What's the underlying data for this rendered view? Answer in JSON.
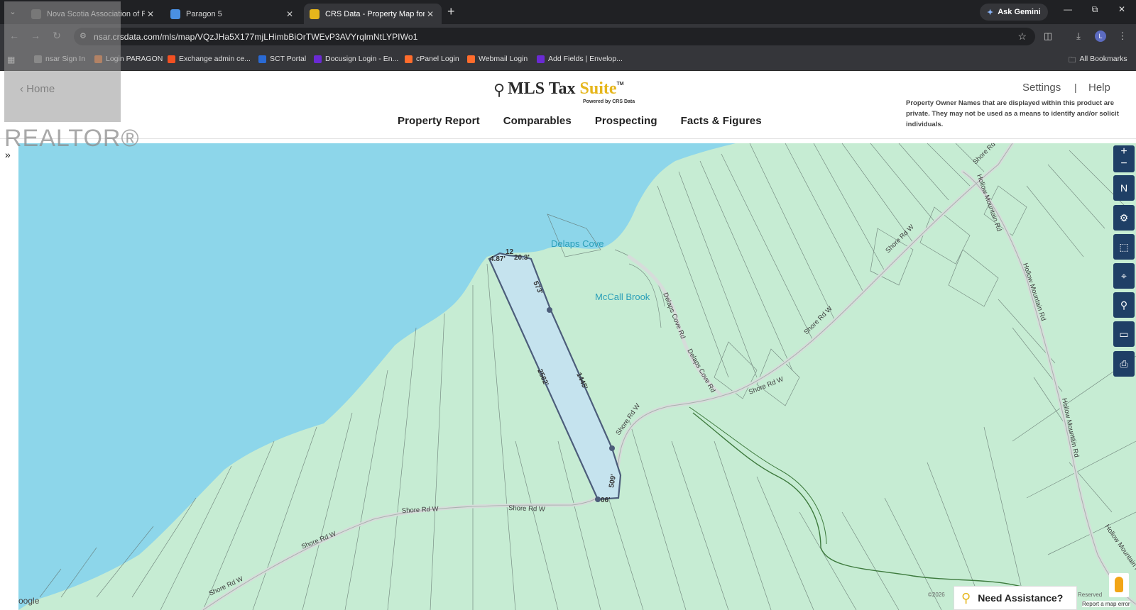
{
  "browser": {
    "tabs": [
      {
        "title": "Nova Scotia Association of Real",
        "icon_color": "#555555",
        "active": false
      },
      {
        "title": "Paragon 5",
        "icon_color": "#4a90e2",
        "active": false
      },
      {
        "title": "CRS Data - Property Map for Sh",
        "icon_color": "#e6b61c",
        "active": true
      }
    ],
    "new_tab": "+",
    "ask_gemini": "Ask Gemini",
    "url": "nsar.crsdata.com/mls/map/VQzJHa5X177mjLHimbBiOrTWEvP3AVYrqlmNtLYPIWo1",
    "profile_initial": "L",
    "bookmarks": [
      {
        "label": "nsar Sign In",
        "color": "#7a7a7a"
      },
      {
        "label": "Login PARAGON",
        "color": "#d46a2a"
      },
      {
        "label": "Exchange admin ce...",
        "color": "#f25022"
      },
      {
        "label": "SCT Portal",
        "color": "#2a6ad4"
      },
      {
        "label": "Docusign Login - En...",
        "color": "#6a2ad4"
      },
      {
        "label": "cPanel Login",
        "color": "#ff6c2c"
      },
      {
        "label": "Webmail Login",
        "color": "#ff6c2c"
      },
      {
        "label": "Add Fields | Envelop...",
        "color": "#6a2ad4"
      }
    ],
    "all_bookmarks": "All Bookmarks"
  },
  "header": {
    "home": "Home",
    "brand_main": "MLS Tax ",
    "brand_accent": "Suite",
    "tm": "TM",
    "powered_by": "Powered by CRS Data",
    "nav": [
      "Property Report",
      "Comparables",
      "Prospecting",
      "Facts & Figures"
    ],
    "settings": "Settings",
    "separator": "|",
    "help": "Help",
    "privacy_notice": "Property Owner Names that are displayed within this product are private. They may not be used as a means to identify and/or solicit individuals."
  },
  "watermark": {
    "text": "REALTOR®"
  },
  "map": {
    "places": [
      "Delaps Cove",
      "McCall Brook"
    ],
    "roads": {
      "shore": "Shore Rd W",
      "hollow": "Hollow Mountain Rd",
      "delaps": "Delaps Cove Rd"
    },
    "dimensions": [
      "4.87'",
      "12",
      "20.3'",
      "573'",
      "2562'",
      "1445'",
      "509'",
      "06'"
    ],
    "controls": [
      "zoom-in",
      "zoom-out",
      "compass",
      "settings",
      "select-area",
      "locate",
      "search",
      "measure",
      "print"
    ],
    "attribution": "©2026",
    "reserved": "Reserved",
    "report_error": "Report a map error",
    "google": "oogle",
    "need_assistance": "Need Assistance?",
    "colors": {
      "water": "#8dd6ea",
      "land": "#c6ecd3",
      "parcel": "#c5e3ee",
      "parcel_line": "#4c5d7a"
    }
  }
}
